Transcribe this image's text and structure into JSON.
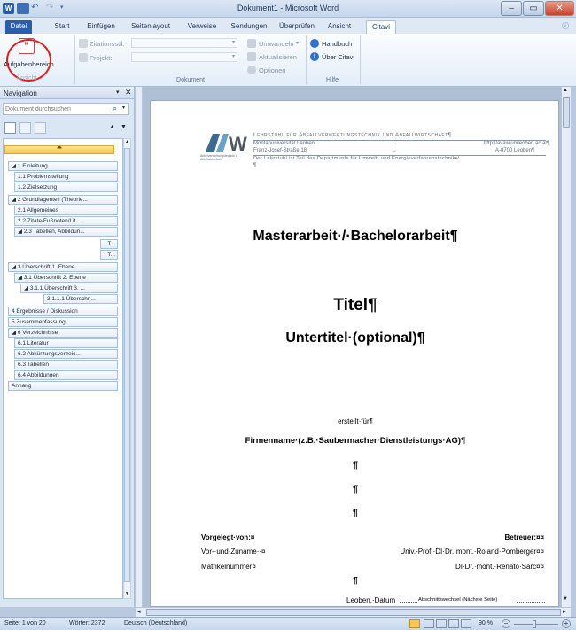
{
  "window": {
    "title": "Dokument1 - Microsoft Word"
  },
  "tabs": [
    "Datei",
    "Start",
    "Einfügen",
    "Seitenlayout",
    "Verweise",
    "Sendungen",
    "Überprüfen",
    "Ansicht",
    "Citavi"
  ],
  "ribbon": {
    "aufgaben_label": "Aufgabenbereich",
    "zitationsstil_label": "Zitationsstil:",
    "projekt_label": "Projekt:",
    "umwandeln_label": "Umwandeln",
    "aktualisieren_label": "Aktualisieren",
    "optionen_label": "Optionen",
    "handbuch_label": "Handbuch",
    "ueber_label": "Über Citavi",
    "group_ansicht": "Ansicht",
    "group_dokument": "Dokument",
    "group_hilfe": "Hilfe"
  },
  "navigation": {
    "title": "Navigation",
    "search_placeholder": "Dokument durchsuchen",
    "items": [
      {
        "label": "1 Einleitung",
        "prefix": "◢ "
      },
      {
        "label": "1.1 Problemstellung",
        "prefix": ""
      },
      {
        "label": "1.2 Zielsetzung",
        "prefix": ""
      },
      {
        "label": "2 Grundlagenteil (Theorie...",
        "prefix": "◢ "
      },
      {
        "label": "2.1 Allgemeines",
        "prefix": ""
      },
      {
        "label": "2.2 Zitate/Fußnoten/Lit...",
        "prefix": ""
      },
      {
        "label": "2.3 Tabellen, Abbildun...",
        "prefix": "◢ "
      },
      {
        "label": "T...",
        "prefix": ""
      },
      {
        "label": "T...",
        "prefix": ""
      },
      {
        "label": "3 Überschrift 1. Ebene",
        "prefix": "◢ "
      },
      {
        "label": "3.1 Überschrift 2. Ebene",
        "prefix": "◢ "
      },
      {
        "label": "3.1.1 Überschrift 3. ...",
        "prefix": "◢ "
      },
      {
        "label": "3.1.1.1 Überschri...",
        "prefix": ""
      },
      {
        "label": "4 Ergebnisse / Diskussion",
        "prefix": ""
      },
      {
        "label": "5 Zusammenfassung",
        "prefix": ""
      },
      {
        "label": "6 Verzeichnisse",
        "prefix": "◢ "
      },
      {
        "label": "6.1 Literatur",
        "prefix": ""
      },
      {
        "label": "6.2 Abkürzungsverzeic...",
        "prefix": ""
      },
      {
        "label": "6.3 Tabellen",
        "prefix": ""
      },
      {
        "label": "6.4 Abbildungen",
        "prefix": ""
      },
      {
        "label": "Anhang",
        "prefix": ""
      }
    ]
  },
  "document": {
    "header_title": "Lehrstuhl für Abfallverwertungstechnik und Abfallwirtschaft¶",
    "header_uni": "Montanuniversität Leoben",
    "header_url": "http://avaw.unileoben.ac.at¶",
    "header_street": "Franz-Josef-Straße 18",
    "header_city": "A-8700 Leoben¶",
    "header_note": "Der Lehrstuhl ist Teil des Departments für Umwelt- und Energieverfahrenstechnik↵",
    "logo_text": "Abfallverwertungstechnik & Abfallwirtschaft",
    "pilcrow": "¶",
    "arrow": "→",
    "main_title": "Masterarbeit·/·Bachelorarbeit¶",
    "titel": "Titel¶",
    "untertitel": "Untertitel·(optional)¶",
    "erstellt": "erstellt·für¶",
    "firma": "Firmenname·(z.B.·Saubermacher·Dienstleistungs·AG)¶",
    "vorgelegt": "Vorgelegt·von:¤",
    "betreuer": "Betreuer:¤¤",
    "vorname": "Vor-·und·Zuname··¤",
    "betreuer1": "Univ.-Prof.·DI·Dr.·mont.·Roland·Pomberger¤¤",
    "matrikel": "Matrikelnummer¤",
    "betreuer2": "DI·Dr.·mont.·Renato·Sarc¤¤",
    "leoben": "Leoben,·Datum",
    "section_break": "Abschnittswechsel (Nächste Seite)"
  },
  "status": {
    "page": "Seite: 1 von 20",
    "words": "Wörter: 2372",
    "language": "Deutsch (Deutschland)",
    "zoom": "90 %"
  },
  "colors": {
    "accent": "#2a5eab",
    "highlight": "#fcd966",
    "annotation": "#e02020"
  }
}
